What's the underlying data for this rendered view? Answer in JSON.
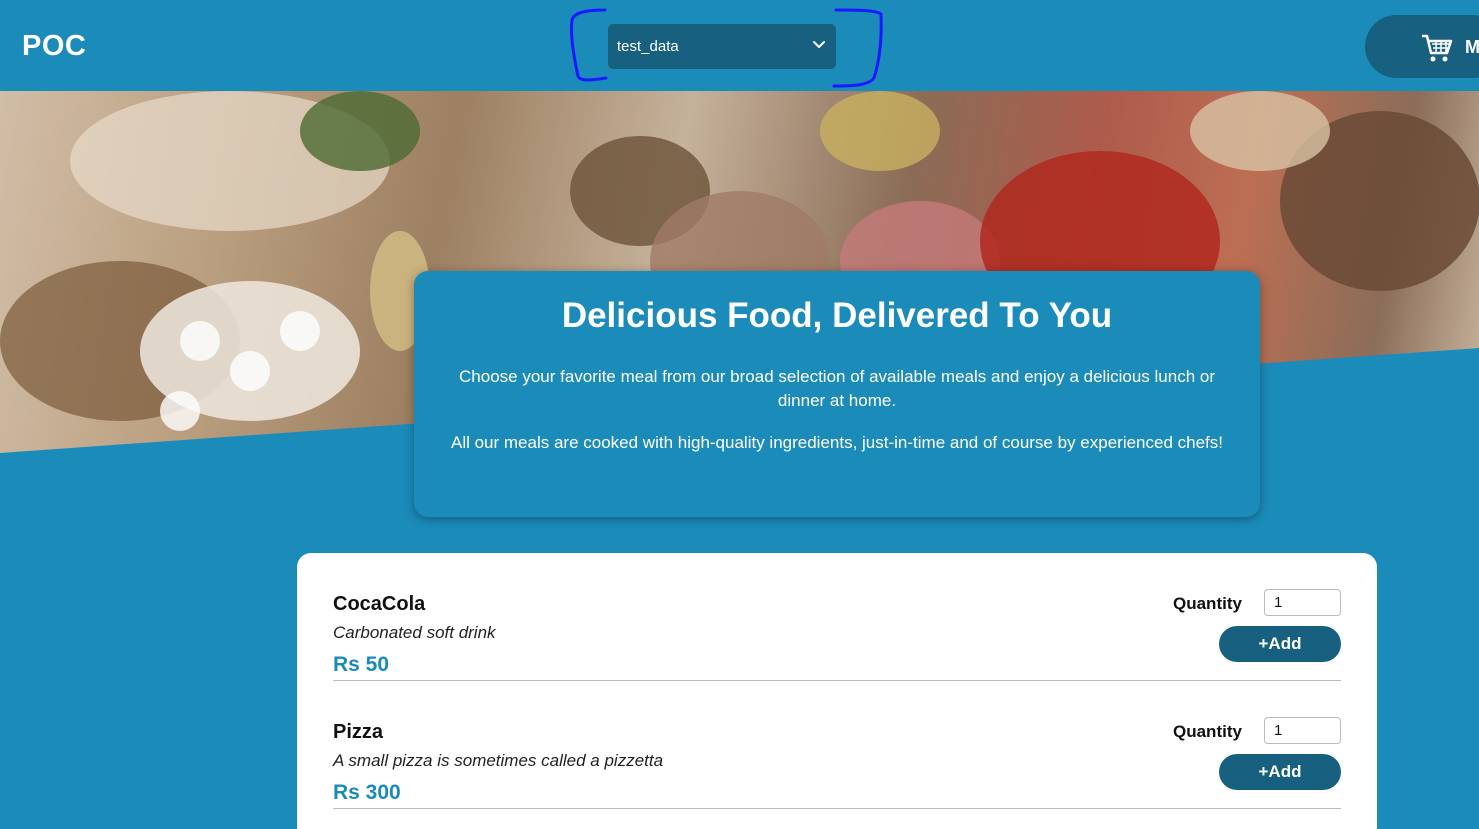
{
  "header": {
    "logo": "POC",
    "select": {
      "value": "test_data"
    },
    "cart": {
      "label": "M"
    }
  },
  "summary": {
    "title": "Delicious Food, Delivered To You",
    "paragraph1": "Choose your favorite meal from our broad selection of available meals and enjoy a delicious lunch or dinner at home.",
    "paragraph2": "All our meals are cooked with high-quality ingredients, just-in-time and of course by experienced chefs!"
  },
  "meals": [
    {
      "name": "CocaCola",
      "description": "Carbonated soft drink",
      "price": "Rs 50",
      "quantity_label": "Quantity",
      "quantity": "1",
      "add_label": "+Add"
    },
    {
      "name": "Pizza",
      "description": "A small pizza is sometimes called a pizzetta",
      "price": "Rs 300",
      "quantity_label": "Quantity",
      "quantity": "1",
      "add_label": "+Add"
    }
  ],
  "colors": {
    "primary": "#1b8bba",
    "dark": "#17607f",
    "annotation": "#1a1aff"
  }
}
